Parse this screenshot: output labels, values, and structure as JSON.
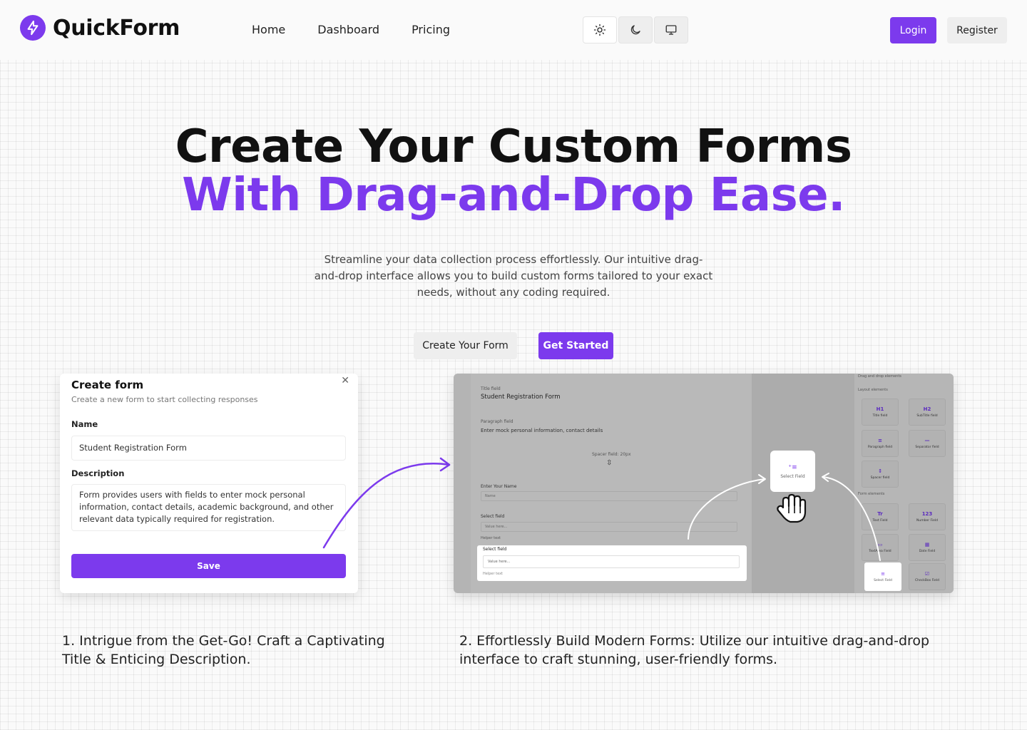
{
  "header": {
    "brand": "QuickForm",
    "nav": [
      "Home",
      "Dashboard",
      "Pricing"
    ],
    "theme_buttons": [
      "sun-icon",
      "moon-icon",
      "monitor-icon"
    ],
    "login_label": "Login",
    "register_label": "Register"
  },
  "hero": {
    "title_line1": "Create Your Custom Forms",
    "title_line2": "With Drag-and-Drop Ease.",
    "subtitle": "Streamline your data collection process effortlessly. Our intuitive drag-and-drop interface allows you to build custom forms tailored to your exact needs, without any coding required.",
    "create_btn": "Create Your Form",
    "start_btn": "Get Started"
  },
  "create_card": {
    "title": "Create form",
    "description": "Create a new form to start collecting responses",
    "name_label": "Name",
    "name_value": "Student Registration Form",
    "description_label": "Description",
    "description_value": "Form provides users with fields to enter mock personal information, contact details, academic background, and other relevant data typically required for registration.",
    "save_label": "Save"
  },
  "builder": {
    "title_field_label": "Title field",
    "title_field_value": "Student Registration Form",
    "paragraph_label": "Paragraph field",
    "paragraph_value": "Enter mock personal information, contact details",
    "spacer_label": "Spacer field: 20px",
    "enter_name_label": "Enter Your Name",
    "enter_name_placeholder": "Name",
    "select_label": "Select field",
    "select_placeholder": "Value here...",
    "helper_text": "Helper text",
    "dragged_tile": "Select Field",
    "sidebar_heading": "Drag and drop elements",
    "layout_heading": "Layout elements",
    "form_heading": "Form elements",
    "layout_tiles": [
      {
        "icon": "H1",
        "label": "Title field"
      },
      {
        "icon": "H2",
        "label": "SubTitle field"
      },
      {
        "icon": "≡",
        "label": "Paragraph field"
      },
      {
        "icon": "—",
        "label": "Separator field"
      },
      {
        "icon": "↕",
        "label": "Spacer field"
      }
    ],
    "form_tiles": [
      {
        "icon": "Tr",
        "label": "Text Field"
      },
      {
        "icon": "123",
        "label": "Number Field"
      },
      {
        "icon": "▭",
        "label": "TextArea Field"
      },
      {
        "icon": "▦",
        "label": "Date Field"
      },
      {
        "icon": "≡",
        "label": "Select Field"
      },
      {
        "icon": "☑",
        "label": "CheckBox Field"
      }
    ]
  },
  "captions": {
    "step1": "1. Intrigue from the Get-Go! Craft a Captivating Title & Enticing Description.",
    "step2": "2. Effortlessly Build Modern Forms: Utilize our intuitive drag-and-drop interface to craft stunning, user-friendly forms."
  },
  "colors": {
    "accent": "#7c3aed",
    "background": "#fafafa"
  }
}
